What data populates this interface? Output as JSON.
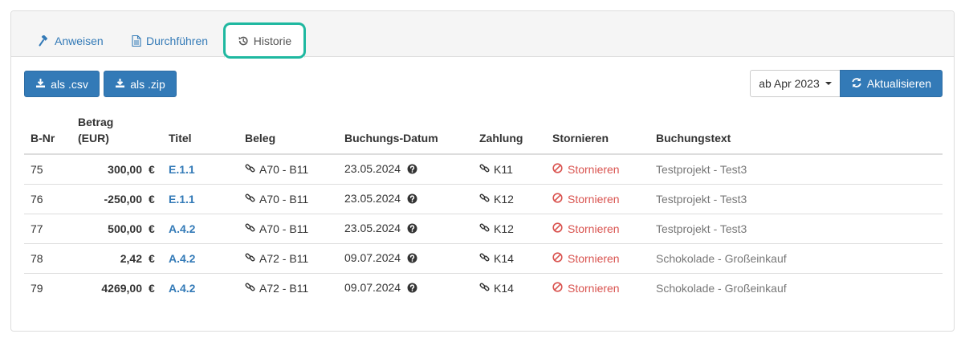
{
  "tabs": {
    "anweisen": "Anweisen",
    "durchfuehren": "Durchführen",
    "historie": "Historie"
  },
  "toolbar": {
    "csv_label": "als .csv",
    "zip_label": "als .zip",
    "date_filter": "ab Apr 2023",
    "refresh_label": "Aktualisieren"
  },
  "table": {
    "headers": {
      "nr": "B-Nr",
      "amount_line1": "Betrag",
      "amount_line2": "(EUR)",
      "titel": "Titel",
      "beleg": "Beleg",
      "datum": "Buchungs-Datum",
      "zahlung": "Zahlung",
      "storno": "Stornieren",
      "text": "Buchungstext"
    },
    "rows": [
      {
        "nr": "75",
        "amount": "300,00",
        "currency": "€",
        "titel": "E.1.1",
        "beleg": "A70 - B11",
        "datum": "23.05.2024",
        "zahlung": "K11",
        "storno": "Stornieren",
        "text": "Testprojekt - Test3"
      },
      {
        "nr": "76",
        "amount": "-250,00",
        "currency": "€",
        "titel": "E.1.1",
        "beleg": "A70 - B11",
        "datum": "23.05.2024",
        "zahlung": "K12",
        "storno": "Stornieren",
        "text": "Testprojekt - Test3"
      },
      {
        "nr": "77",
        "amount": "500,00",
        "currency": "€",
        "titel": "A.4.2",
        "beleg": "A70 - B11",
        "datum": "23.05.2024",
        "zahlung": "K12",
        "storno": "Stornieren",
        "text": "Testprojekt - Test3"
      },
      {
        "nr": "78",
        "amount": "2,42",
        "currency": "€",
        "titel": "A.4.2",
        "beleg": "A72 - B11",
        "datum": "09.07.2024",
        "zahlung": "K14",
        "storno": "Stornieren",
        "text": "Schokolade - Großeinkauf"
      },
      {
        "nr": "79",
        "amount": "4269,00",
        "currency": "€",
        "titel": "A.4.2",
        "beleg": "A72 - B11",
        "datum": "09.07.2024",
        "zahlung": "K14",
        "storno": "Stornieren",
        "text": "Schokolade - Großeinkauf"
      }
    ]
  },
  "colors": {
    "primary": "#337ab7",
    "danger": "#d9534f",
    "highlight_ring": "#1eb8a0",
    "muted_text": "#777777"
  },
  "icons": {
    "anweisen": "gavel-icon",
    "durchfuehren": "document-icon",
    "historie": "history-icon",
    "download": "download-icon",
    "refresh": "refresh-icon",
    "link": "link-icon",
    "question": "question-circle-icon",
    "cancel": "ban-icon"
  }
}
